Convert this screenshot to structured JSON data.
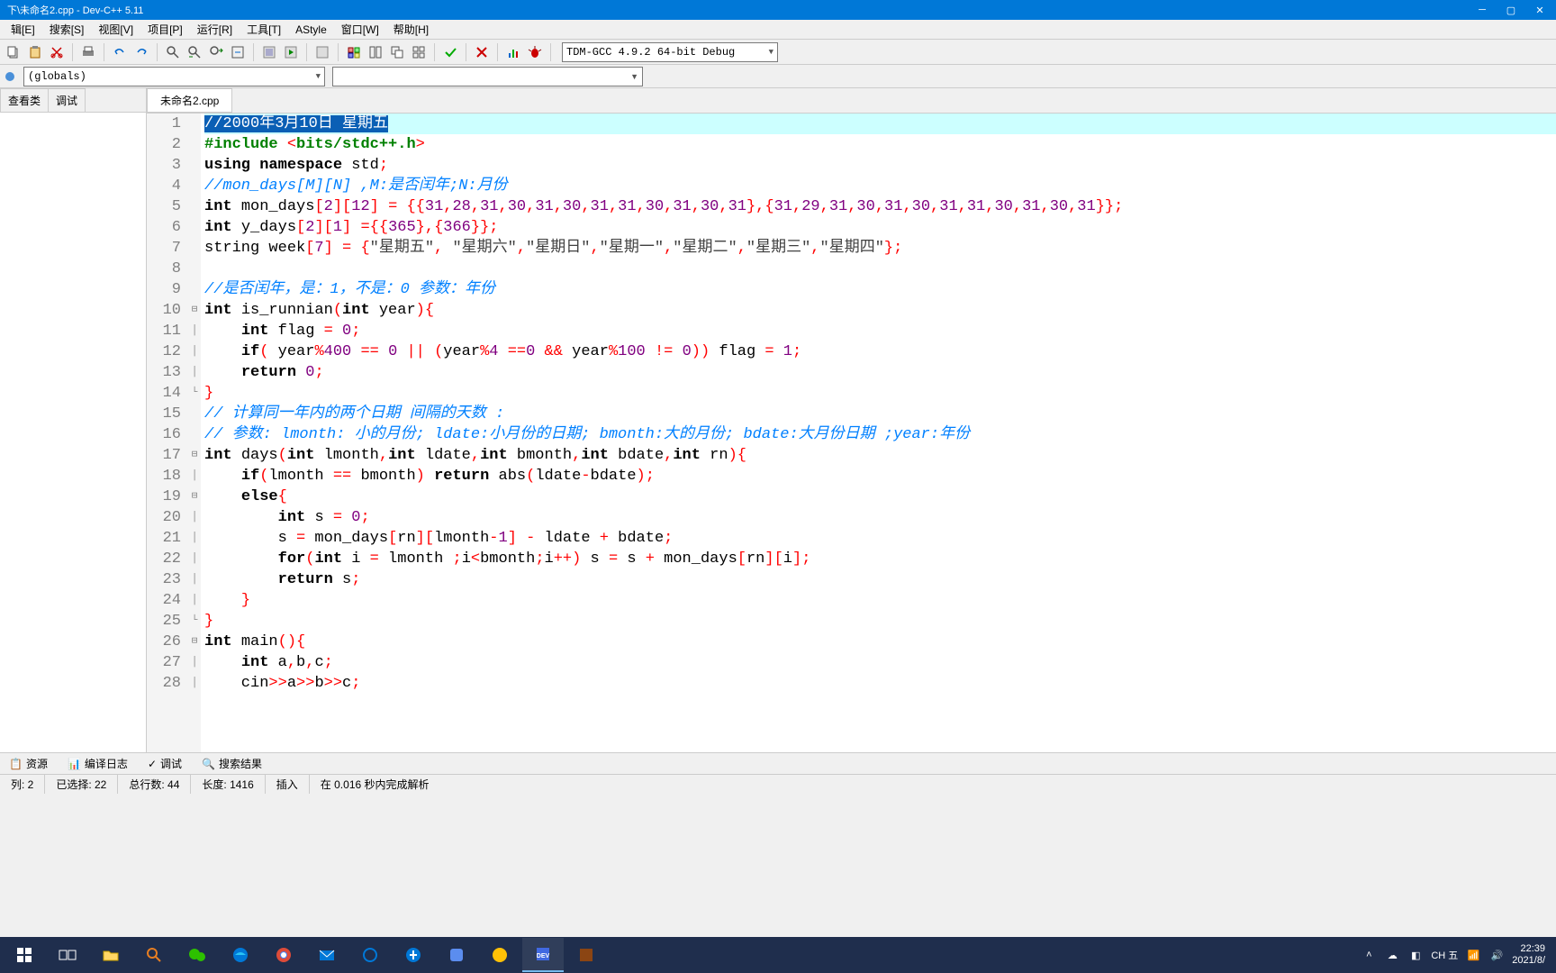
{
  "titlebar": {
    "title": "下\\未命名2.cpp - Dev-C++ 5.11"
  },
  "menus": [
    "辑[E]",
    "搜索[S]",
    "视图[V]",
    "项目[P]",
    "运行[R]",
    "工具[T]",
    "AStyle",
    "窗口[W]",
    "帮助[H]"
  ],
  "compiler": "TDM-GCC 4.9.2 64-bit Debug",
  "scope": "(globals)",
  "sidebar_tabs": [
    "查看类",
    "调试"
  ],
  "file_tab": "未命名2.cpp",
  "code_lines": [
    {
      "n": 1,
      "fold": "",
      "seg": [
        [
          "sel",
          "//2000年3月10日 星期五"
        ]
      ]
    },
    {
      "n": 2,
      "fold": "",
      "seg": [
        [
          "c-pp",
          "#include "
        ],
        [
          "c-paren",
          "<"
        ],
        [
          "c-pp",
          "bits/stdc++.h"
        ],
        [
          "c-paren",
          ">"
        ]
      ]
    },
    {
      "n": 3,
      "fold": "",
      "seg": [
        [
          "c-kw",
          "using namespace "
        ],
        [
          "c-id",
          "std"
        ],
        [
          "c-op",
          ";"
        ]
      ]
    },
    {
      "n": 4,
      "fold": "",
      "seg": [
        [
          "c-comment",
          "//mon_days[M][N] ,M:是否闰年;N:月份"
        ]
      ]
    },
    {
      "n": 5,
      "fold": "",
      "seg": [
        [
          "c-kw",
          "int "
        ],
        [
          "c-id",
          "mon_days"
        ],
        [
          "c-paren",
          "["
        ],
        [
          "c-num",
          "2"
        ],
        [
          "c-paren",
          "]["
        ],
        [
          "c-num",
          "12"
        ],
        [
          "c-paren",
          "]"
        ],
        [
          "c-id",
          " "
        ],
        [
          "c-op",
          "="
        ],
        [
          "c-id",
          " "
        ],
        [
          "c-paren",
          "{{"
        ],
        [
          "c-num",
          "31"
        ],
        [
          "c-op",
          ","
        ],
        [
          "c-num",
          "28"
        ],
        [
          "c-op",
          ","
        ],
        [
          "c-num",
          "31"
        ],
        [
          "c-op",
          ","
        ],
        [
          "c-num",
          "30"
        ],
        [
          "c-op",
          ","
        ],
        [
          "c-num",
          "31"
        ],
        [
          "c-op",
          ","
        ],
        [
          "c-num",
          "30"
        ],
        [
          "c-op",
          ","
        ],
        [
          "c-num",
          "31"
        ],
        [
          "c-op",
          ","
        ],
        [
          "c-num",
          "31"
        ],
        [
          "c-op",
          ","
        ],
        [
          "c-num",
          "30"
        ],
        [
          "c-op",
          ","
        ],
        [
          "c-num",
          "31"
        ],
        [
          "c-op",
          ","
        ],
        [
          "c-num",
          "30"
        ],
        [
          "c-op",
          ","
        ],
        [
          "c-num",
          "31"
        ],
        [
          "c-paren",
          "},{"
        ],
        [
          "c-num",
          "31"
        ],
        [
          "c-op",
          ","
        ],
        [
          "c-num",
          "29"
        ],
        [
          "c-op",
          ","
        ],
        [
          "c-num",
          "31"
        ],
        [
          "c-op",
          ","
        ],
        [
          "c-num",
          "30"
        ],
        [
          "c-op",
          ","
        ],
        [
          "c-num",
          "31"
        ],
        [
          "c-op",
          ","
        ],
        [
          "c-num",
          "30"
        ],
        [
          "c-op",
          ","
        ],
        [
          "c-num",
          "31"
        ],
        [
          "c-op",
          ","
        ],
        [
          "c-num",
          "31"
        ],
        [
          "c-op",
          ","
        ],
        [
          "c-num",
          "30"
        ],
        [
          "c-op",
          ","
        ],
        [
          "c-num",
          "31"
        ],
        [
          "c-op",
          ","
        ],
        [
          "c-num",
          "30"
        ],
        [
          "c-op",
          ","
        ],
        [
          "c-num",
          "31"
        ],
        [
          "c-paren",
          "}}"
        ],
        [
          "c-op",
          ";"
        ]
      ]
    },
    {
      "n": 6,
      "fold": "",
      "seg": [
        [
          "c-kw",
          "int "
        ],
        [
          "c-id",
          "y_days"
        ],
        [
          "c-paren",
          "["
        ],
        [
          "c-num",
          "2"
        ],
        [
          "c-paren",
          "]["
        ],
        [
          "c-num",
          "1"
        ],
        [
          "c-paren",
          "]"
        ],
        [
          "c-id",
          " "
        ],
        [
          "c-op",
          "="
        ],
        [
          "c-paren",
          "{{"
        ],
        [
          "c-num",
          "365"
        ],
        [
          "c-paren",
          "},{"
        ],
        [
          "c-num",
          "366"
        ],
        [
          "c-paren",
          "}}"
        ],
        [
          "c-op",
          ";"
        ]
      ]
    },
    {
      "n": 7,
      "fold": "",
      "seg": [
        [
          "c-id",
          "string week"
        ],
        [
          "c-paren",
          "["
        ],
        [
          "c-num",
          "7"
        ],
        [
          "c-paren",
          "]"
        ],
        [
          "c-id",
          " "
        ],
        [
          "c-op",
          "="
        ],
        [
          "c-id",
          " "
        ],
        [
          "c-paren",
          "{"
        ],
        [
          "c-str",
          "\"星期五\""
        ],
        [
          "c-op",
          ","
        ],
        [
          "c-id",
          " "
        ],
        [
          "c-str",
          "\"星期六\""
        ],
        [
          "c-op",
          ","
        ],
        [
          "c-str",
          "\"星期日\""
        ],
        [
          "c-op",
          ","
        ],
        [
          "c-str",
          "\"星期一\""
        ],
        [
          "c-op",
          ","
        ],
        [
          "c-str",
          "\"星期二\""
        ],
        [
          "c-op",
          ","
        ],
        [
          "c-str",
          "\"星期三\""
        ],
        [
          "c-op",
          ","
        ],
        [
          "c-str",
          "\"星期四\""
        ],
        [
          "c-paren",
          "}"
        ],
        [
          "c-op",
          ";"
        ]
      ]
    },
    {
      "n": 8,
      "fold": "",
      "seg": []
    },
    {
      "n": 9,
      "fold": "",
      "seg": [
        [
          "c-comment",
          "//是否闰年，是：1，不是：0 参数：年份"
        ]
      ]
    },
    {
      "n": 10,
      "fold": "⊟",
      "seg": [
        [
          "c-kw",
          "int "
        ],
        [
          "c-id",
          "is_runnian"
        ],
        [
          "c-paren",
          "("
        ],
        [
          "c-kw",
          "int "
        ],
        [
          "c-id",
          "year"
        ],
        [
          "c-paren",
          "){"
        ]
      ]
    },
    {
      "n": 11,
      "fold": "│",
      "seg": [
        [
          "c-id",
          "    "
        ],
        [
          "c-kw",
          "int "
        ],
        [
          "c-id",
          "flag "
        ],
        [
          "c-op",
          "="
        ],
        [
          "c-id",
          " "
        ],
        [
          "c-num",
          "0"
        ],
        [
          "c-op",
          ";"
        ]
      ]
    },
    {
      "n": 12,
      "fold": "│",
      "seg": [
        [
          "c-id",
          "    "
        ],
        [
          "c-kw",
          "if"
        ],
        [
          "c-paren",
          "("
        ],
        [
          "c-id",
          " year"
        ],
        [
          "c-op",
          "%"
        ],
        [
          "c-num",
          "400"
        ],
        [
          "c-id",
          " "
        ],
        [
          "c-op",
          "=="
        ],
        [
          "c-id",
          " "
        ],
        [
          "c-num",
          "0"
        ],
        [
          "c-id",
          " "
        ],
        [
          "c-op",
          "||"
        ],
        [
          "c-id",
          " "
        ],
        [
          "c-paren",
          "("
        ],
        [
          "c-id",
          "year"
        ],
        [
          "c-op",
          "%"
        ],
        [
          "c-num",
          "4"
        ],
        [
          "c-id",
          " "
        ],
        [
          "c-op",
          "=="
        ],
        [
          "c-num",
          "0"
        ],
        [
          "c-id",
          " "
        ],
        [
          "c-op",
          "&&"
        ],
        [
          "c-id",
          " year"
        ],
        [
          "c-op",
          "%"
        ],
        [
          "c-num",
          "100"
        ],
        [
          "c-id",
          " "
        ],
        [
          "c-op",
          "!="
        ],
        [
          "c-id",
          " "
        ],
        [
          "c-num",
          "0"
        ],
        [
          "c-paren",
          "))"
        ],
        [
          "c-id",
          " flag "
        ],
        [
          "c-op",
          "="
        ],
        [
          "c-id",
          " "
        ],
        [
          "c-num",
          "1"
        ],
        [
          "c-op",
          ";"
        ]
      ]
    },
    {
      "n": 13,
      "fold": "│",
      "seg": [
        [
          "c-id",
          "    "
        ],
        [
          "c-kw",
          "return "
        ],
        [
          "c-num",
          "0"
        ],
        [
          "c-op",
          ";"
        ]
      ]
    },
    {
      "n": 14,
      "fold": "└",
      "seg": [
        [
          "c-paren",
          "}"
        ]
      ]
    },
    {
      "n": 15,
      "fold": "",
      "seg": [
        [
          "c-comment",
          "// 计算同一年内的两个日期 间隔的天数 :"
        ]
      ]
    },
    {
      "n": 16,
      "fold": "",
      "seg": [
        [
          "c-comment",
          "// 参数: lmonth: 小的月份; ldate:小月份的日期; bmonth:大的月份; bdate:大月份日期 ;year:年份"
        ]
      ]
    },
    {
      "n": 17,
      "fold": "⊟",
      "seg": [
        [
          "c-kw",
          "int "
        ],
        [
          "c-id",
          "days"
        ],
        [
          "c-paren",
          "("
        ],
        [
          "c-kw",
          "int "
        ],
        [
          "c-id",
          "lmonth"
        ],
        [
          "c-op",
          ","
        ],
        [
          "c-kw",
          "int "
        ],
        [
          "c-id",
          "ldate"
        ],
        [
          "c-op",
          ","
        ],
        [
          "c-kw",
          "int "
        ],
        [
          "c-id",
          "bmonth"
        ],
        [
          "c-op",
          ","
        ],
        [
          "c-kw",
          "int "
        ],
        [
          "c-id",
          "bdate"
        ],
        [
          "c-op",
          ","
        ],
        [
          "c-kw",
          "int "
        ],
        [
          "c-id",
          "rn"
        ],
        [
          "c-paren",
          "){"
        ]
      ]
    },
    {
      "n": 18,
      "fold": "│",
      "seg": [
        [
          "c-id",
          "    "
        ],
        [
          "c-kw",
          "if"
        ],
        [
          "c-paren",
          "("
        ],
        [
          "c-id",
          "lmonth "
        ],
        [
          "c-op",
          "=="
        ],
        [
          "c-id",
          " bmonth"
        ],
        [
          "c-paren",
          ")"
        ],
        [
          "c-id",
          " "
        ],
        [
          "c-kw",
          "return "
        ],
        [
          "c-id",
          "abs"
        ],
        [
          "c-paren",
          "("
        ],
        [
          "c-id",
          "ldate"
        ],
        [
          "c-op",
          "-"
        ],
        [
          "c-id",
          "bdate"
        ],
        [
          "c-paren",
          ")"
        ],
        [
          "c-op",
          ";"
        ]
      ]
    },
    {
      "n": 19,
      "fold": "⊟",
      "seg": [
        [
          "c-id",
          "    "
        ],
        [
          "c-kw",
          "else"
        ],
        [
          "c-paren",
          "{"
        ]
      ]
    },
    {
      "n": 20,
      "fold": "│",
      "seg": [
        [
          "c-id",
          "        "
        ],
        [
          "c-kw",
          "int "
        ],
        [
          "c-id",
          "s "
        ],
        [
          "c-op",
          "="
        ],
        [
          "c-id",
          " "
        ],
        [
          "c-num",
          "0"
        ],
        [
          "c-op",
          ";"
        ]
      ]
    },
    {
      "n": 21,
      "fold": "│",
      "seg": [
        [
          "c-id",
          "        s "
        ],
        [
          "c-op",
          "="
        ],
        [
          "c-id",
          " mon_days"
        ],
        [
          "c-paren",
          "["
        ],
        [
          "c-id",
          "rn"
        ],
        [
          "c-paren",
          "]["
        ],
        [
          "c-id",
          "lmonth"
        ],
        [
          "c-op",
          "-"
        ],
        [
          "c-num",
          "1"
        ],
        [
          "c-paren",
          "]"
        ],
        [
          "c-id",
          " "
        ],
        [
          "c-op",
          "-"
        ],
        [
          "c-id",
          " ldate "
        ],
        [
          "c-op",
          "+"
        ],
        [
          "c-id",
          " bdate"
        ],
        [
          "c-op",
          ";"
        ]
      ]
    },
    {
      "n": 22,
      "fold": "│",
      "seg": [
        [
          "c-id",
          "        "
        ],
        [
          "c-kw",
          "for"
        ],
        [
          "c-paren",
          "("
        ],
        [
          "c-kw",
          "int "
        ],
        [
          "c-id",
          "i "
        ],
        [
          "c-op",
          "="
        ],
        [
          "c-id",
          " lmonth "
        ],
        [
          "c-op",
          ";"
        ],
        [
          "c-id",
          "i"
        ],
        [
          "c-op",
          "<"
        ],
        [
          "c-id",
          "bmonth"
        ],
        [
          "c-op",
          ";"
        ],
        [
          "c-id",
          "i"
        ],
        [
          "c-op",
          "++"
        ],
        [
          "c-paren",
          ")"
        ],
        [
          "c-id",
          " s "
        ],
        [
          "c-op",
          "="
        ],
        [
          "c-id",
          " s "
        ],
        [
          "c-op",
          "+"
        ],
        [
          "c-id",
          " mon_days"
        ],
        [
          "c-paren",
          "["
        ],
        [
          "c-id",
          "rn"
        ],
        [
          "c-paren",
          "]["
        ],
        [
          "c-id",
          "i"
        ],
        [
          "c-paren",
          "]"
        ],
        [
          "c-op",
          ";"
        ]
      ]
    },
    {
      "n": 23,
      "fold": "│",
      "seg": [
        [
          "c-id",
          "        "
        ],
        [
          "c-kw",
          "return "
        ],
        [
          "c-id",
          "s"
        ],
        [
          "c-op",
          ";"
        ]
      ]
    },
    {
      "n": 24,
      "fold": "│",
      "seg": [
        [
          "c-id",
          "    "
        ],
        [
          "c-paren",
          "}"
        ]
      ]
    },
    {
      "n": 25,
      "fold": "└",
      "seg": [
        [
          "c-paren",
          "}"
        ]
      ]
    },
    {
      "n": 26,
      "fold": "⊟",
      "seg": [
        [
          "c-kw",
          "int "
        ],
        [
          "c-id",
          "main"
        ],
        [
          "c-paren",
          "(){"
        ]
      ]
    },
    {
      "n": 27,
      "fold": "│",
      "seg": [
        [
          "c-id",
          "    "
        ],
        [
          "c-kw",
          "int "
        ],
        [
          "c-id",
          "a"
        ],
        [
          "c-op",
          ","
        ],
        [
          "c-id",
          "b"
        ],
        [
          "c-op",
          ","
        ],
        [
          "c-id",
          "c"
        ],
        [
          "c-op",
          ";"
        ]
      ]
    },
    {
      "n": 28,
      "fold": "│",
      "seg": [
        [
          "c-id",
          "    cin"
        ],
        [
          "c-op",
          ">>"
        ],
        [
          "c-id",
          "a"
        ],
        [
          "c-op",
          ">>"
        ],
        [
          "c-id",
          "b"
        ],
        [
          "c-op",
          ">>"
        ],
        [
          "c-id",
          "c"
        ],
        [
          "c-op",
          ";"
        ]
      ]
    }
  ],
  "bottom_tabs": [
    {
      "icon": "📋",
      "label": "资源"
    },
    {
      "icon": "📊",
      "label": "编译日志"
    },
    {
      "icon": "✓",
      "label": "调试"
    },
    {
      "icon": "🔍",
      "label": "搜索结果"
    }
  ],
  "status": {
    "col": "列:  2",
    "sel": "已选择:  22",
    "total": "总行数:  44",
    "len": "长度: 1416",
    "mode": "插入",
    "parse": "在 0.016 秒内完成解析"
  },
  "taskbar": {
    "time": "22:39",
    "date": "2021/8/",
    "ime": "CH 五"
  }
}
